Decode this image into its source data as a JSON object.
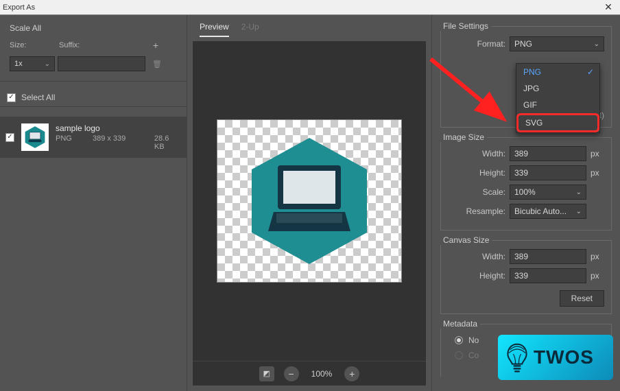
{
  "window": {
    "title": "Export As"
  },
  "left": {
    "scale_all_label": "Scale All",
    "size_label": "Size:",
    "suffix_label": "Suffix:",
    "size_value": "1x",
    "select_all_label": "Select All",
    "asset": {
      "name": "sample logo",
      "format": "PNG",
      "dimensions": "389 x 339",
      "filesize": "28.6 KB"
    }
  },
  "center": {
    "tabs": {
      "preview": "Preview",
      "two_up": "2-Up"
    },
    "zoom": "100%"
  },
  "right": {
    "file_settings_label": "File Settings",
    "format_label": "Format:",
    "format_value": "PNG",
    "format_options": {
      "png": "PNG",
      "jpg": "JPG",
      "gif": "GIF",
      "svg": "SVG"
    },
    "paren_hint": "t)",
    "image_size_label": "Image Size",
    "width_label": "Width:",
    "width_value": "389",
    "height_label": "Height:",
    "height_value": "339",
    "scale_label": "Scale:",
    "scale_value": "100%",
    "resample_label": "Resample:",
    "resample_value": "Bicubic Auto...",
    "px": "px",
    "canvas_size_label": "Canvas Size",
    "canvas_width_label": "Width:",
    "canvas_width_value": "389",
    "canvas_height_label": "Height:",
    "canvas_height_value": "339",
    "reset_label": "Reset",
    "metadata_label": "Metadata",
    "radio_none": "No",
    "radio_copyright": "Co"
  },
  "banner": {
    "text": "TWOS"
  }
}
